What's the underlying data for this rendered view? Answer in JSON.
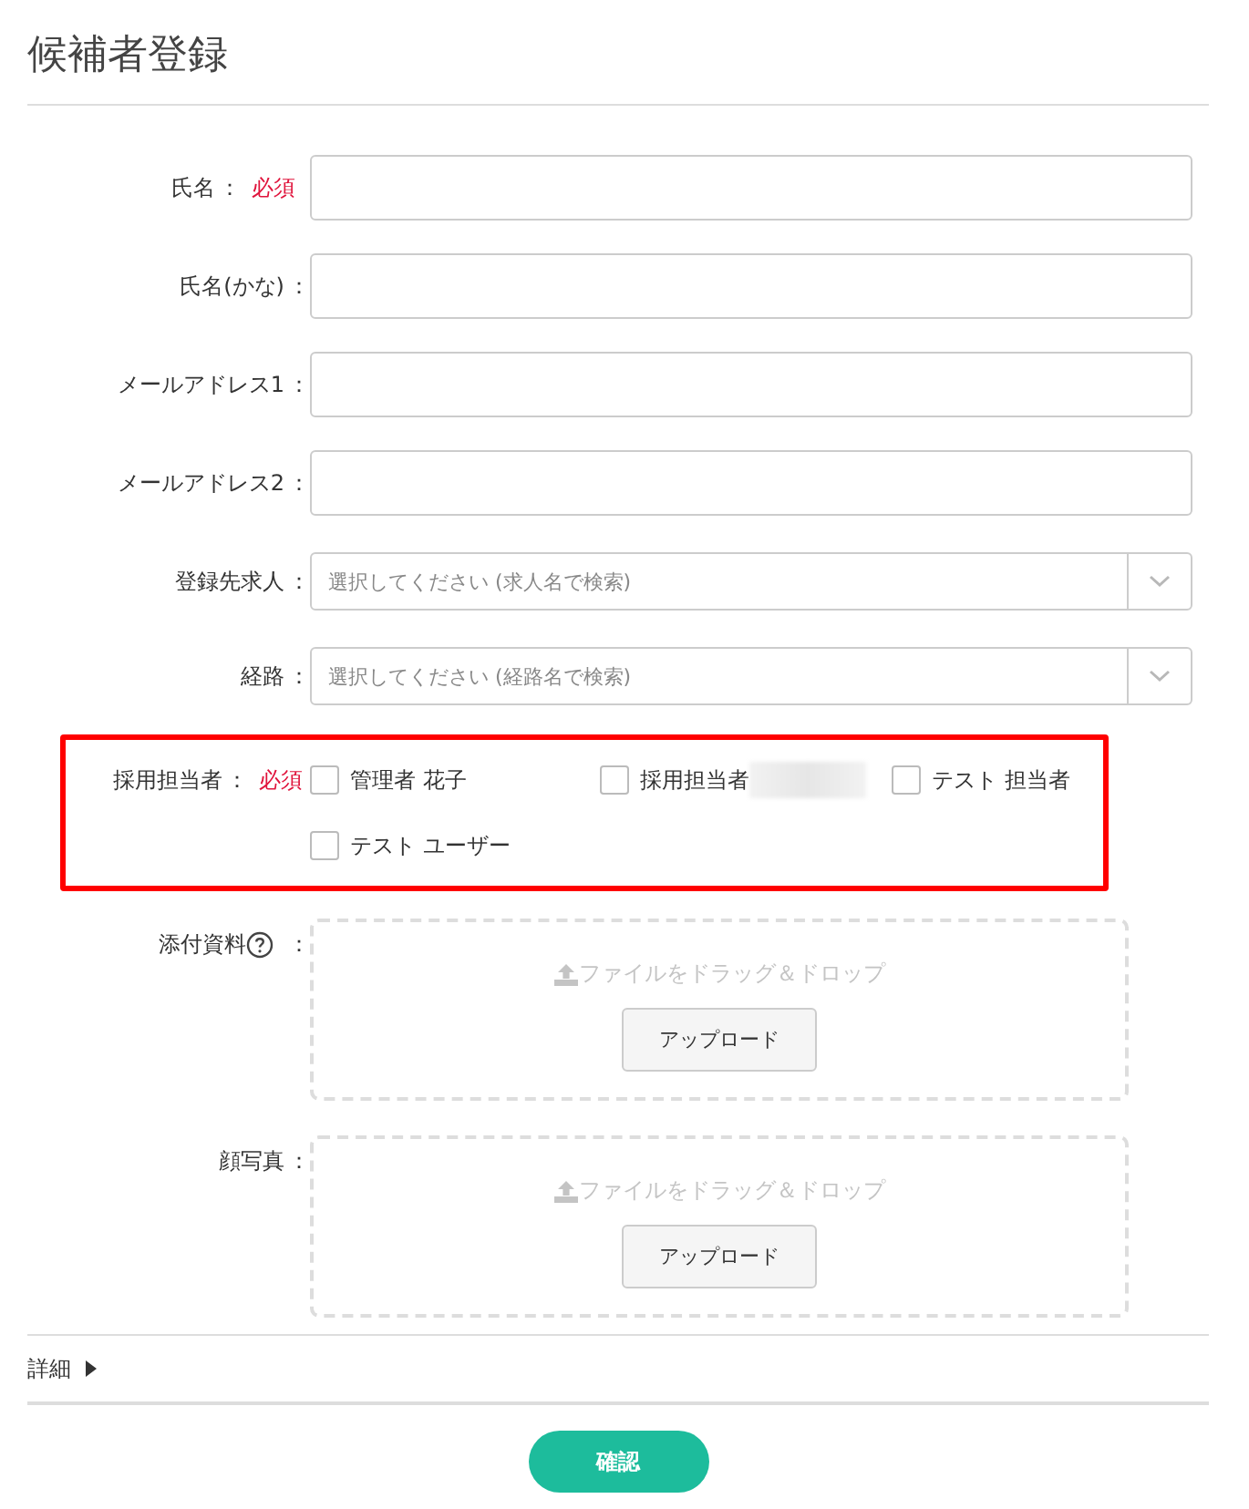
{
  "title": "候補者登録",
  "fields": [
    {
      "kind": "text",
      "label": "氏名",
      "colon": "：",
      "required": "必須"
    },
    {
      "kind": "text",
      "label": "氏名(かな)",
      "colon": "："
    },
    {
      "kind": "text",
      "label": "メールアドレス1",
      "colon": "："
    },
    {
      "kind": "text",
      "label": "メールアドレス2",
      "colon": "："
    },
    {
      "kind": "select",
      "label": "登録先求人",
      "colon": "：",
      "placeholder": "選択してください (求人名で検索)"
    },
    {
      "kind": "select",
      "label": "経路",
      "colon": "：",
      "placeholder": "選択してください (経路名で検索)"
    },
    {
      "kind": "checkboxes",
      "label": "採用担当者",
      "colon": "：",
      "required": "必須",
      "highlighted": true,
      "options": [
        {
          "label": "管理者 花子",
          "checked": false
        },
        {
          "label": "採用担当者",
          "checked": false,
          "blurred": true
        },
        {
          "label": "テスト 担当者",
          "checked": false
        },
        {
          "label": "テスト ユーザー",
          "checked": false
        }
      ]
    },
    {
      "kind": "upload",
      "label": "添付資料",
      "colon": "：",
      "help": true,
      "drop_text": "ファイルをドラッグ＆ドロップ",
      "button": "アップロード"
    },
    {
      "kind": "upload",
      "label": "顔写真",
      "colon": "：",
      "drop_text": "ファイルをドラッグ＆ドロップ",
      "button": "アップロード"
    }
  ],
  "details": {
    "label": "詳細",
    "expanded": false
  },
  "submit": "確認"
}
